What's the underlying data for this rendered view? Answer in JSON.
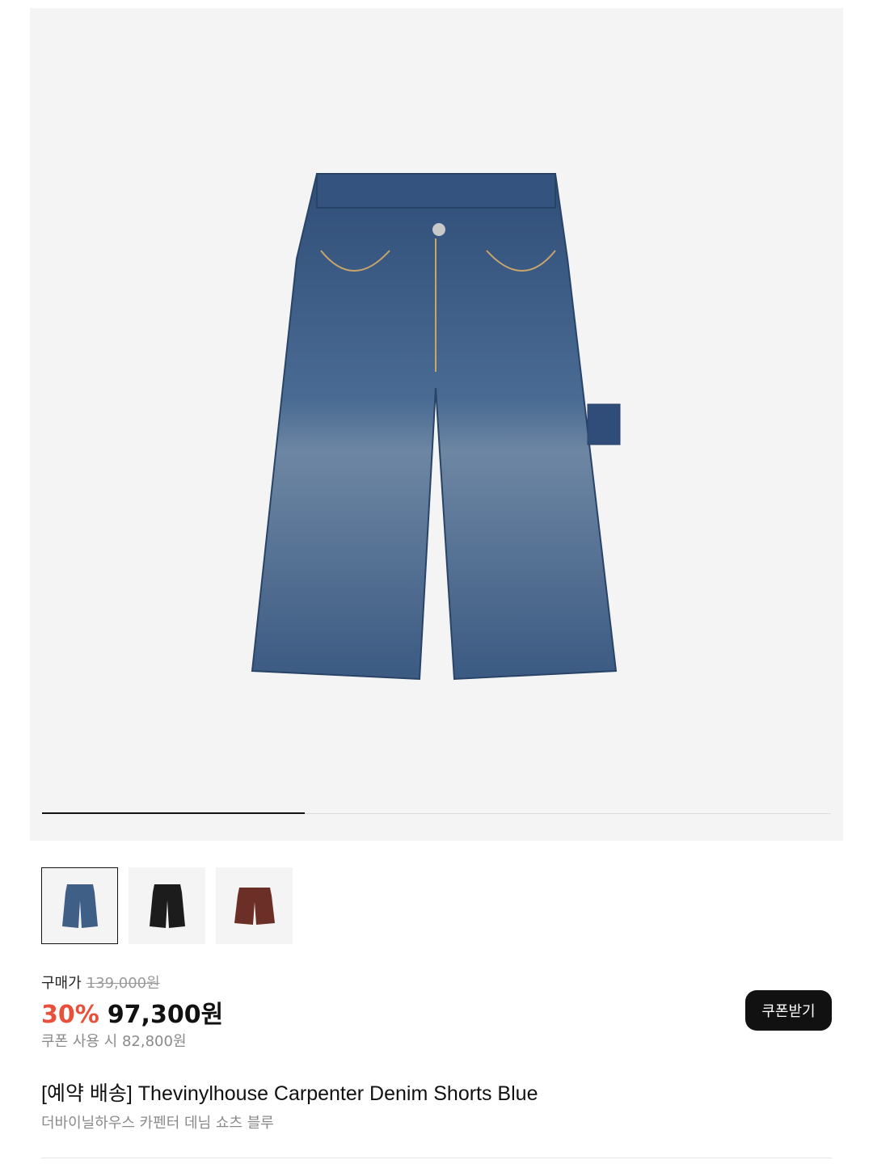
{
  "gallery": {
    "progress_fraction": 0.333,
    "images": [
      {
        "alt": "blue denim shorts",
        "color": "#3f5f86",
        "selected": true
      },
      {
        "alt": "black denim shorts",
        "color": "#1c1c1c",
        "selected": false
      },
      {
        "alt": "brown denim shorts",
        "color": "#6b2f27",
        "selected": false
      }
    ]
  },
  "price": {
    "label": "구매가",
    "original": "139,000원",
    "discount": "30%",
    "sale": "97,300원",
    "coupon_note": "쿠폰 사용 시 82,800원"
  },
  "coupon_button": {
    "label": "쿠폰받기"
  },
  "product": {
    "title": "[예약 배송] Thevinylhouse Carpenter Denim Shorts Blue",
    "subtitle": "더바이닐하우스 카펜터 데님 쇼츠 블루"
  },
  "colors": {
    "accent_discount": "#e8503a",
    "button_bg": "#111111"
  }
}
